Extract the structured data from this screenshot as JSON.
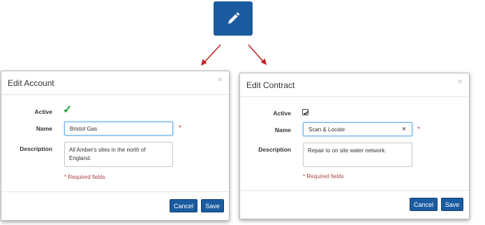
{
  "colors": {
    "primary": "#1b5ca0",
    "arrow": "#c0242a",
    "required": "#c9302c",
    "check": "#1e9b3a"
  },
  "edit_tile": {
    "icon": "pencil-icon"
  },
  "account_dialog": {
    "title": "Edit Account",
    "close": "×",
    "active_label": "Active",
    "active_value": "✓",
    "name_label": "Name",
    "name_value": "Bristol Gas",
    "required_star": "*",
    "description_label": "Description",
    "description_value": "All Amber's sites in the north of England.",
    "required_note": "* Required fields",
    "cancel_label": "Cancel",
    "save_label": "Save"
  },
  "contract_dialog": {
    "title": "Edit Contract",
    "close": "×",
    "active_label": "Active",
    "active_checked": true,
    "name_label": "Name",
    "name_value": "Scan & Locate",
    "clear_icon": "×",
    "required_star": "*",
    "description_label": "Description",
    "description_value": "Repair to on site water network.",
    "required_note": "* Required fields",
    "cancel_label": "Cancel",
    "save_label": "Save"
  }
}
